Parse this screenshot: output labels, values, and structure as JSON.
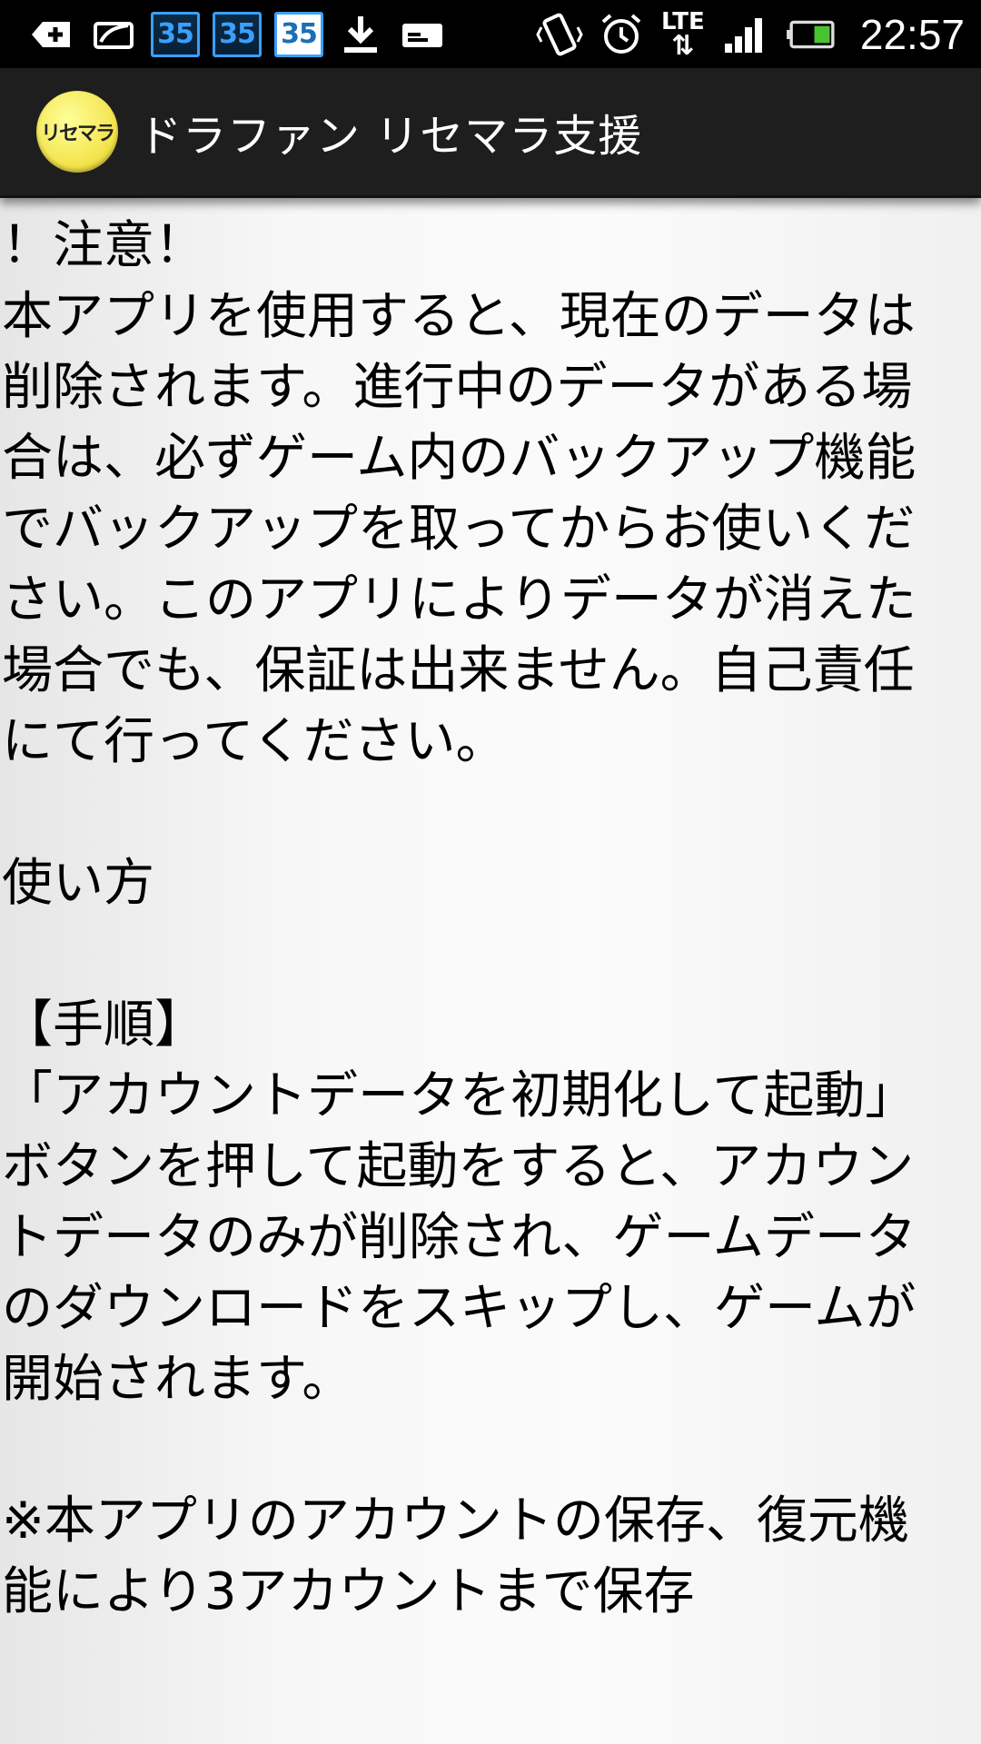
{
  "status_bar": {
    "time": "22:57",
    "network_label": "LTE",
    "network_arrows": "⇅",
    "calendar_badges": [
      "35",
      "35",
      "35"
    ],
    "icons": [
      "add-notification-icon",
      "card-icon",
      "calendar-icon",
      "calendar-icon",
      "calendar-icon",
      "download-icon",
      "sd-card-icon",
      "vibrate-icon",
      "alarm-icon",
      "lte-icon",
      "signal-icon",
      "battery-icon"
    ]
  },
  "action_bar": {
    "logo_text": "リセマラ",
    "title": "ドラファン リセマラ支援"
  },
  "content": {
    "text": "！注意！\n本アプリを使用すると、現在のデータは削除されます。進行中のデータがある場合は、必ずゲーム内のバックアップ機能でバックアップを取ってからお使いください。このアプリによりデータが消えた場合でも、保証は出来ません。自己責任にて行ってください。\n\n使い方\n\n【手順】\n「アカウントデータを初期化して起動」ボタンを押して起動をすると、アカウントデータのみが削除され、ゲームデータのダウンロードをスキップし、ゲームが開始されます。\n\n※本アプリのアカウントの保存、復元機能により3アカウントまで保存"
  }
}
